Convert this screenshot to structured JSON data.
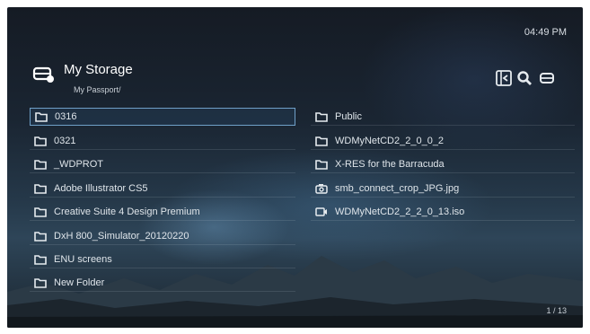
{
  "status": {
    "time": "04:49 PM"
  },
  "header": {
    "title": "My Storage",
    "path": "My Passport/"
  },
  "toolbar": {
    "icons": [
      "back-icon",
      "search-icon",
      "storage-icon"
    ]
  },
  "left_items": [
    {
      "label": "0316",
      "type": "folder",
      "selected": true
    },
    {
      "label": "0321",
      "type": "folder"
    },
    {
      "label": "_WDPROT",
      "type": "folder"
    },
    {
      "label": "Adobe Illustrator CS5",
      "type": "folder"
    },
    {
      "label": "Creative Suite 4 Design Premium",
      "type": "folder"
    },
    {
      "label": "DxH 800_Simulator_20120220",
      "type": "folder"
    },
    {
      "label": "ENU screens",
      "type": "folder"
    },
    {
      "label": "New Folder",
      "type": "folder"
    }
  ],
  "right_items": [
    {
      "label": "Public",
      "type": "folder"
    },
    {
      "label": "WDMyNetCD2_2_0_0_2",
      "type": "folder"
    },
    {
      "label": "X-RES for the Barracuda",
      "type": "folder"
    },
    {
      "label": "smb_connect_crop_JPG.jpg",
      "type": "photo"
    },
    {
      "label": "WDMyNetCD2_2_2_0_13.iso",
      "type": "video"
    }
  ],
  "pagination": {
    "text": "1 / 13"
  },
  "colors": {
    "selection_border": "#6fa0c8",
    "text": "#dfe5ea"
  }
}
